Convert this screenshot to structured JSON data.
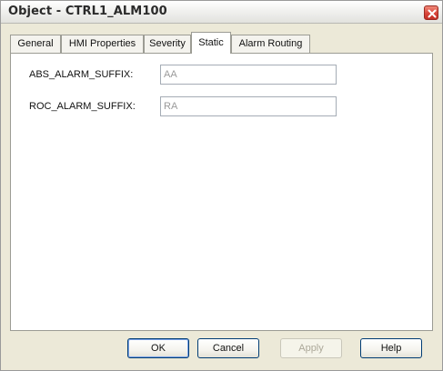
{
  "window": {
    "title": "Object - CTRL1_ALM100"
  },
  "tabs": [
    {
      "label": "General",
      "active": false
    },
    {
      "label": "HMI Properties",
      "active": false
    },
    {
      "label": "Severity",
      "active": false
    },
    {
      "label": "Static",
      "active": true
    },
    {
      "label": "Alarm Routing",
      "active": false
    }
  ],
  "fields": {
    "abs_label": "ABS_ALARM_SUFFIX:",
    "abs_value": "AA",
    "roc_label": "ROC_ALARM_SUFFIX:",
    "roc_value": "RA"
  },
  "buttons": {
    "ok": "OK",
    "cancel": "Cancel",
    "apply": "Apply",
    "help": "Help"
  },
  "icons": {
    "close": "close-icon"
  }
}
